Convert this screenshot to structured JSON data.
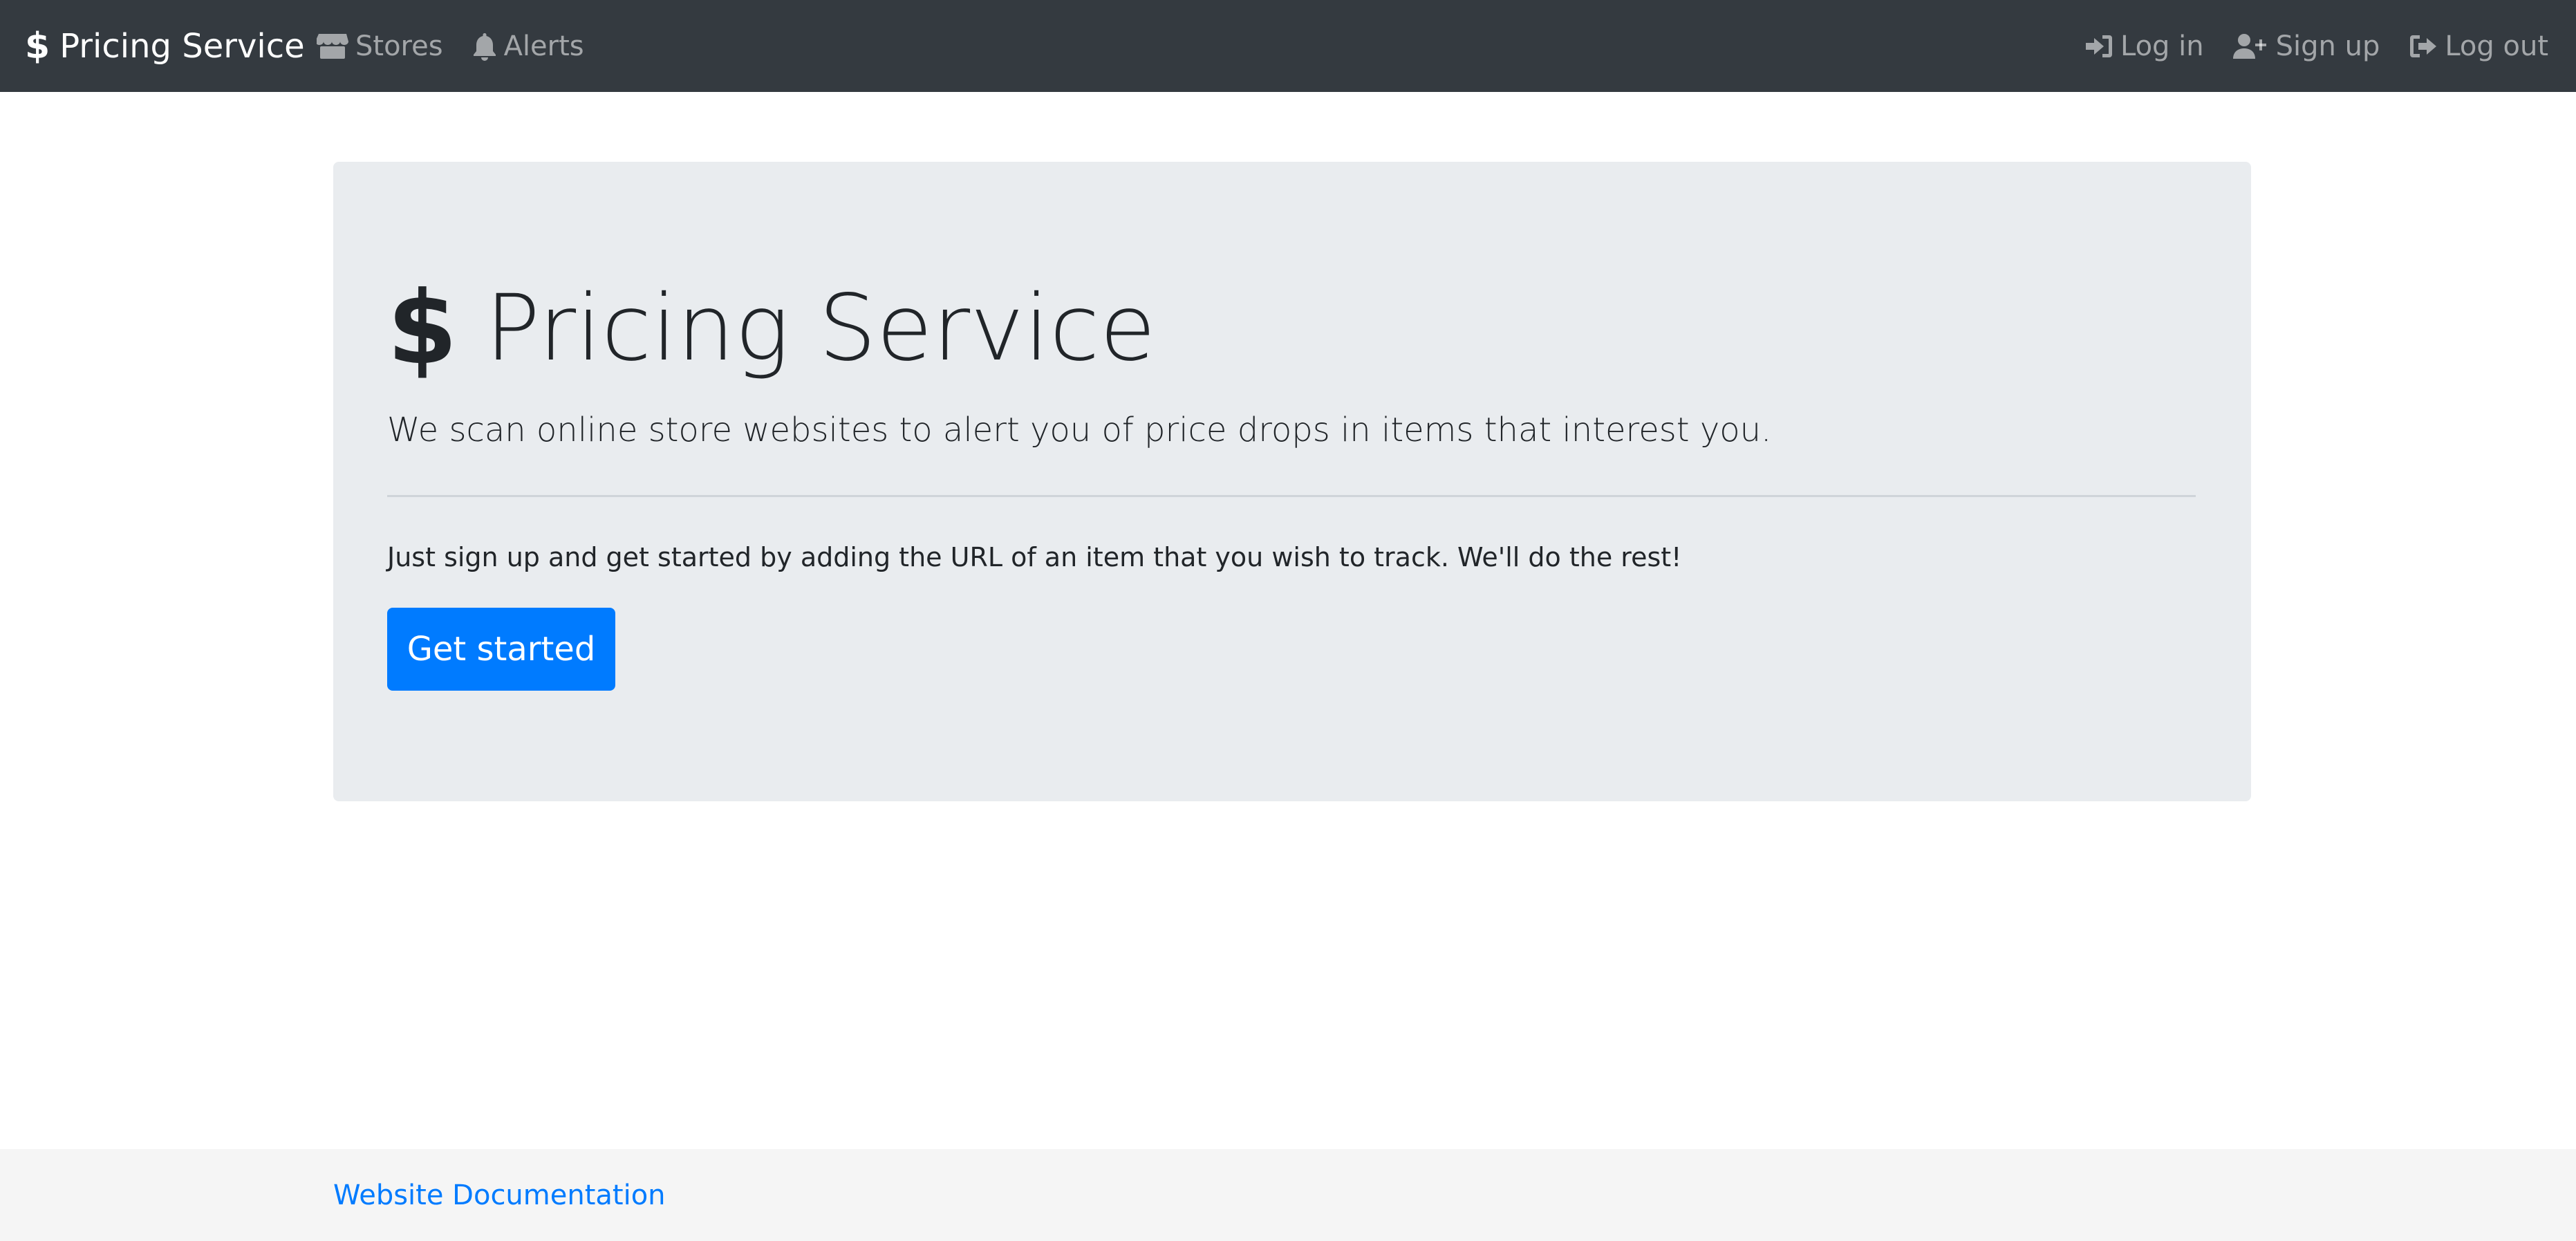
{
  "navbar": {
    "brand": {
      "icon": "dollar-sign-icon",
      "symbol": "$",
      "label": "Pricing Service"
    },
    "left_links": [
      {
        "icon": "store-icon",
        "label": "Stores"
      },
      {
        "icon": "bell-icon",
        "label": "Alerts"
      }
    ],
    "right_links": [
      {
        "icon": "sign-in-icon",
        "label": "Log in"
      },
      {
        "icon": "user-plus-icon",
        "label": "Sign up"
      },
      {
        "icon": "sign-out-icon",
        "label": "Log out"
      }
    ]
  },
  "hero": {
    "icon": "dollar-sign-icon",
    "symbol": "$",
    "title": "Pricing Service",
    "lead": "We scan online store websites to alert you of price drops in items that interest you.",
    "body": "Just sign up and get started by adding the URL of an item that you wish to track. We'll do the rest!",
    "cta_label": "Get started"
  },
  "footer": {
    "link_label": "Website Documentation"
  },
  "colors": {
    "navbar_bg": "#343a40",
    "jumbotron_bg": "#e9ecef",
    "primary": "#007bff",
    "footer_bg": "#f5f5f5"
  }
}
